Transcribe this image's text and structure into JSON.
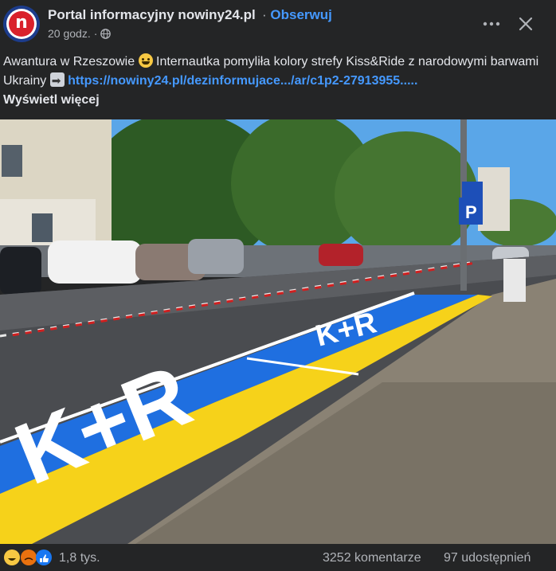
{
  "post": {
    "page_name": "Portal informacyjny nowiny24.pl",
    "separator": " · ",
    "follow_label": "Obserwuj",
    "time": "20 godz.",
    "time_separator": "·",
    "avatar_letter": "n",
    "text_before_emoji": "Awantura w Rzeszowie ",
    "text_after_emoji": " Internautka pomyliła kolory strefy Kiss&Ride z narodowymi barwami Ukrainy ",
    "link": "https://nowiny24.pl/dezinformujace.../ar/c1p2-27913955.....",
    "see_more": "Wyświetl więcej",
    "emoji_name": "grinning-sweat-emoji",
    "arrow_emoji_name": "right-arrow-emoji"
  },
  "photo": {
    "road_marking_text": "K+R",
    "sign_letter": "P",
    "colors": {
      "blue": "#1f6fe0",
      "yellow": "#f6d21a",
      "sky": "#5aa6e8"
    }
  },
  "footer": {
    "reaction_icons": [
      "laugh-reaction-icon",
      "angry-reaction-icon",
      "like-reaction-icon"
    ],
    "reactions_count": "1,8 tys.",
    "comments": "3252 komentarze",
    "shares": "97 udostępnień"
  },
  "colors": {
    "link": "#4599ff",
    "background": "#242526",
    "text": "#e4e6eb",
    "muted": "#b0b3b8"
  }
}
